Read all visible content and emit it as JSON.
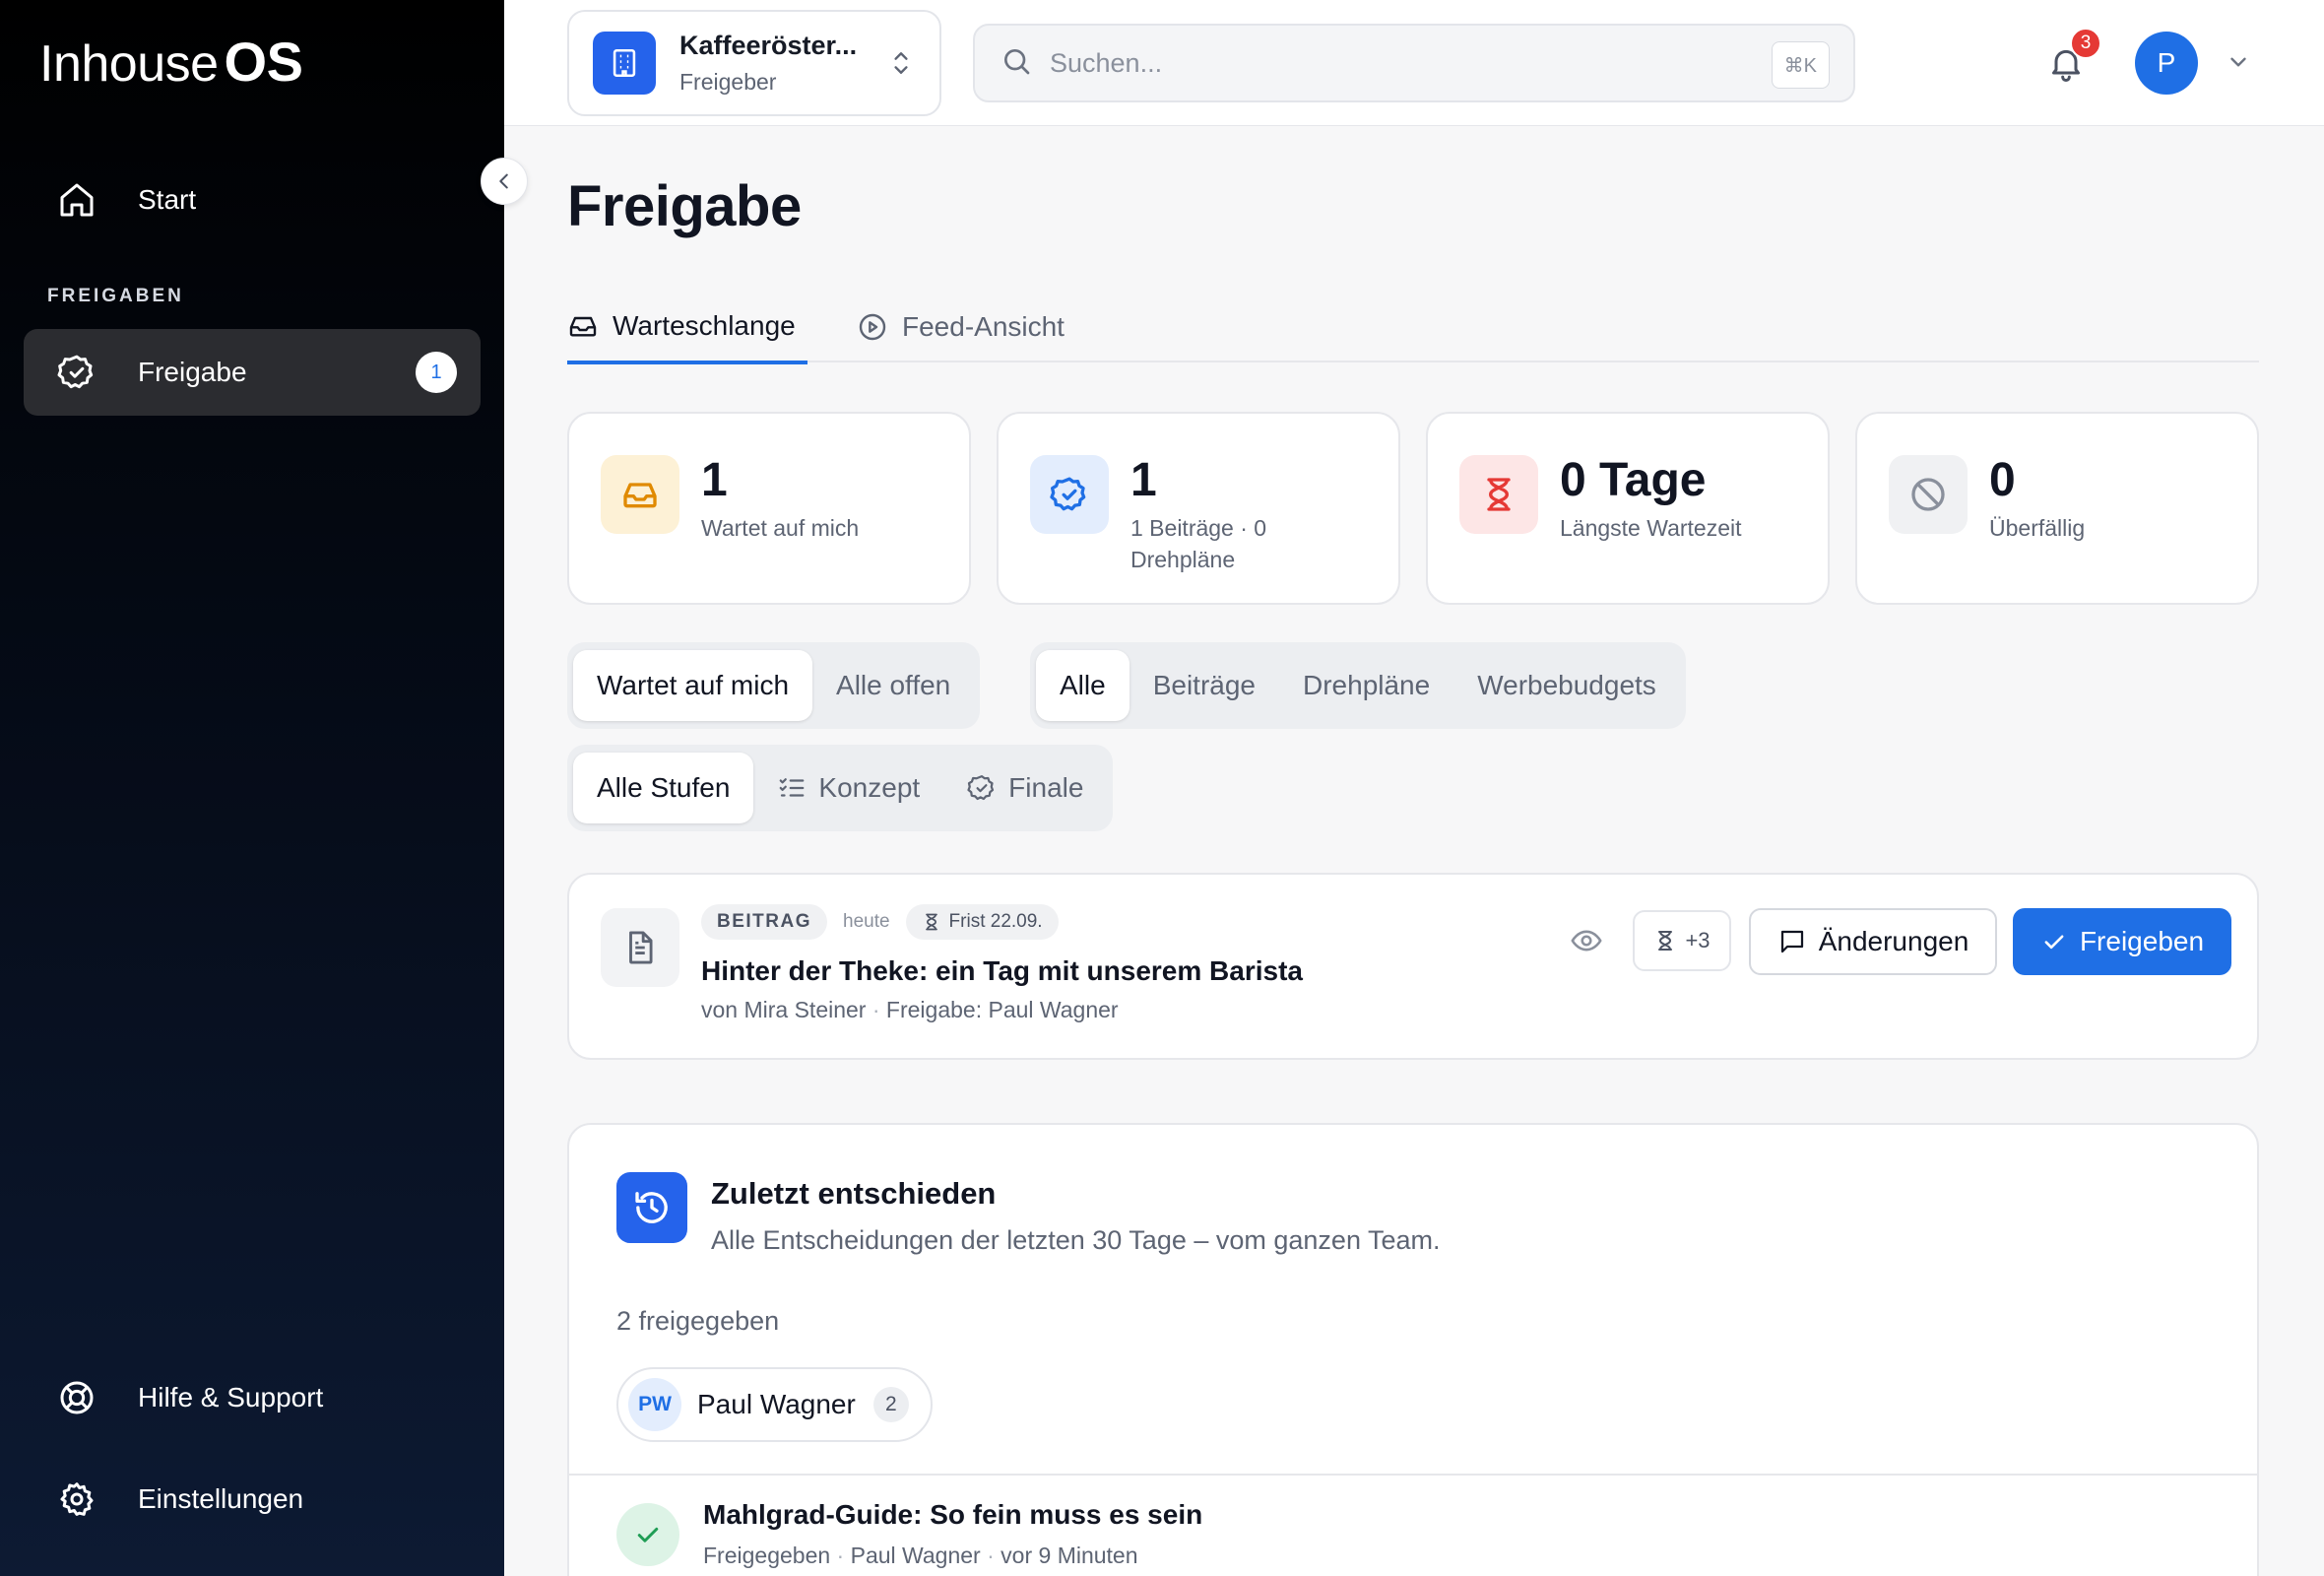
{
  "brand": {
    "logo_light": "Inhouse",
    "logo_bold": "OS"
  },
  "sidebar": {
    "start_label": "Start",
    "section_label": "FREIGABEN",
    "active_item": {
      "label": "Freigabe",
      "badge": "1"
    },
    "help_label": "Hilfe & Support",
    "settings_label": "Einstellungen"
  },
  "topbar": {
    "org_name": "Kaffeeröster...",
    "org_role": "Freigeber",
    "search_placeholder": "Suchen...",
    "search_shortcut": "⌘K",
    "notifications_count": "3",
    "avatar_initial": "P"
  },
  "page": {
    "title": "Freigabe",
    "tabs": [
      {
        "label": "Warteschlange",
        "active": true
      },
      {
        "label": "Feed-Ansicht",
        "active": false
      }
    ]
  },
  "stats": [
    {
      "value": "1",
      "label": "Wartet auf mich",
      "icon": "inbox-icon",
      "color": "#f5a623"
    },
    {
      "value": "1",
      "label": "1 Beiträge · 0 Drehpläne",
      "icon": "badge-check-icon",
      "color": "#1f6fe5"
    },
    {
      "value": "0 Tage",
      "label": "Längste Wartezeit",
      "icon": "hourglass-icon",
      "color": "#e53935"
    },
    {
      "value": "0",
      "label": "Überfällig",
      "icon": "ban-icon",
      "color": "#8a909c"
    }
  ],
  "filters": {
    "scope": [
      "Wartet auf mich",
      "Alle offen"
    ],
    "scope_selected": "Wartet auf mich",
    "type": [
      "Alle",
      "Beiträge",
      "Drehpläne",
      "Werbebudgets"
    ],
    "type_selected": "Alle",
    "stage": [
      "Alle Stufen",
      "Konzept",
      "Finale"
    ],
    "stage_selected": "Alle Stufen"
  },
  "queue_item": {
    "type": "BEITRAG",
    "date": "heute",
    "deadline": "Frist 22.09.",
    "title": "Hinter der Theke: ein Tag mit unserem Barista",
    "author": "von Mira Steiner",
    "approver": "Freigabe: Paul Wagner",
    "timer_label": "+3",
    "changes_label": "Änderungen",
    "approve_label": "Freigeben"
  },
  "recent": {
    "title": "Zuletzt entschieden",
    "subtitle": "Alle Entscheidungen der letzten 30 Tage – vom ganzen Team.",
    "count_label": "2 freigegeben",
    "person": {
      "initials": "PW",
      "name": "Paul Wagner",
      "count": "2"
    },
    "entry": {
      "title": "Mahlgrad-Guide: So fein muss es sein",
      "status": "Freigegeben",
      "by": "Paul Wagner",
      "when": "vor 9 Minuten"
    }
  }
}
